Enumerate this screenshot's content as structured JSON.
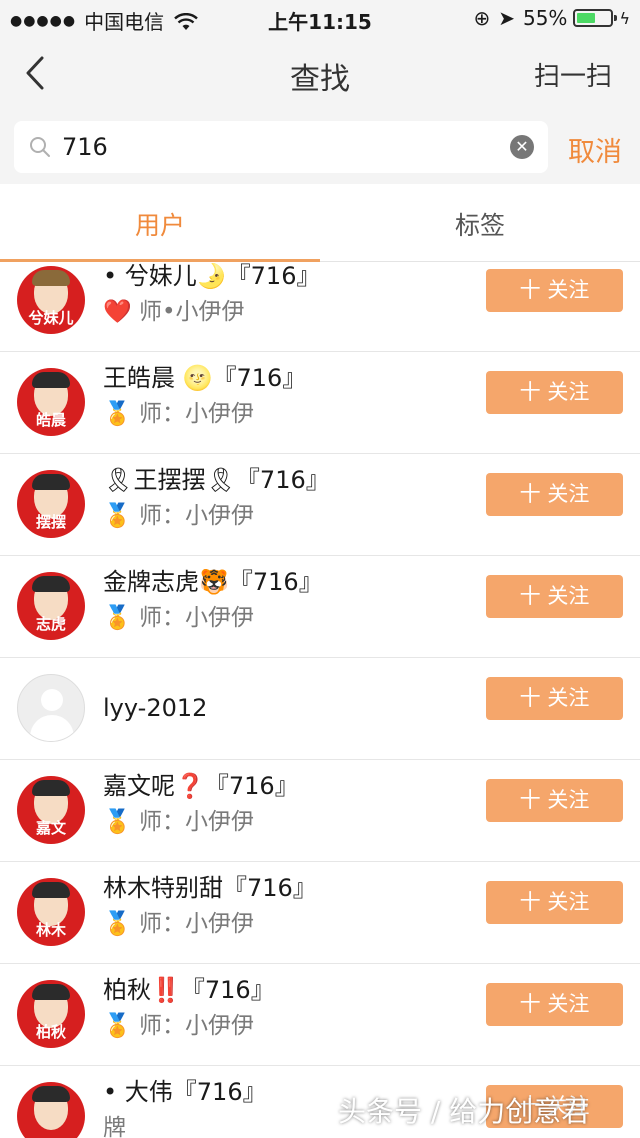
{
  "status_bar": {
    "signal": "●●●●●",
    "carrier": "中国电信",
    "time": "上午11:15",
    "battery": "55%",
    "battery_level": 0.55,
    "lock_glyph": "⊕",
    "location_glyph": "➤",
    "charging_glyph": "ϟ"
  },
  "nav": {
    "title": "查找",
    "scan_label": "扫一扫"
  },
  "search": {
    "value": "716",
    "clear_glyph": "✕",
    "cancel_label": "取消"
  },
  "tabs": [
    {
      "label": "用户",
      "active": true
    },
    {
      "label": "标签",
      "active": false
    }
  ],
  "users": [
    {
      "name": "• 兮妹儿🌛『716』",
      "mentor": "❤️ 师•小伊伊",
      "avatar_tag": "兮妹儿",
      "follow_label": "十 关注"
    },
    {
      "name": "王皓晨 🌝『716』",
      "mentor": "🏅 师：小伊伊",
      "avatar_tag": "皓晨",
      "follow_label": "十 关注"
    },
    {
      "name": "🎗王摆摆🎗『716』",
      "mentor": "🏅 师：小伊伊",
      "avatar_tag": "摆摆",
      "follow_label": "十 关注"
    },
    {
      "name": "金牌志虎🐯『716』",
      "mentor": "🏅 师：小伊伊",
      "avatar_tag": "志虎",
      "follow_label": "十 关注"
    },
    {
      "name": "lyy-2012",
      "mentor": "",
      "avatar_tag": "",
      "follow_label": "十 关注"
    },
    {
      "name": "嘉文呢❓『716』",
      "mentor": "🏅 师：小伊伊",
      "avatar_tag": "嘉文",
      "follow_label": "十 关注"
    },
    {
      "name": "林木特别甜『716』",
      "mentor": "🏅 师：小伊伊",
      "avatar_tag": "林木",
      "follow_label": "十 关注"
    },
    {
      "name": "柏秋‼️『716』",
      "mentor": "🏅 师：小伊伊",
      "avatar_tag": "柏秋",
      "follow_label": "十 关注"
    },
    {
      "name": "• 大伟『716』",
      "mentor": "牌",
      "avatar_tag": "",
      "follow_label": "十 关注"
    }
  ],
  "watermark": "头条号 / 给力创意君",
  "colors": {
    "accent": "#f08a3c",
    "follow_button": "#f5a66b",
    "avatar_red": "#d61f1f",
    "battery_green": "#4cd964"
  }
}
